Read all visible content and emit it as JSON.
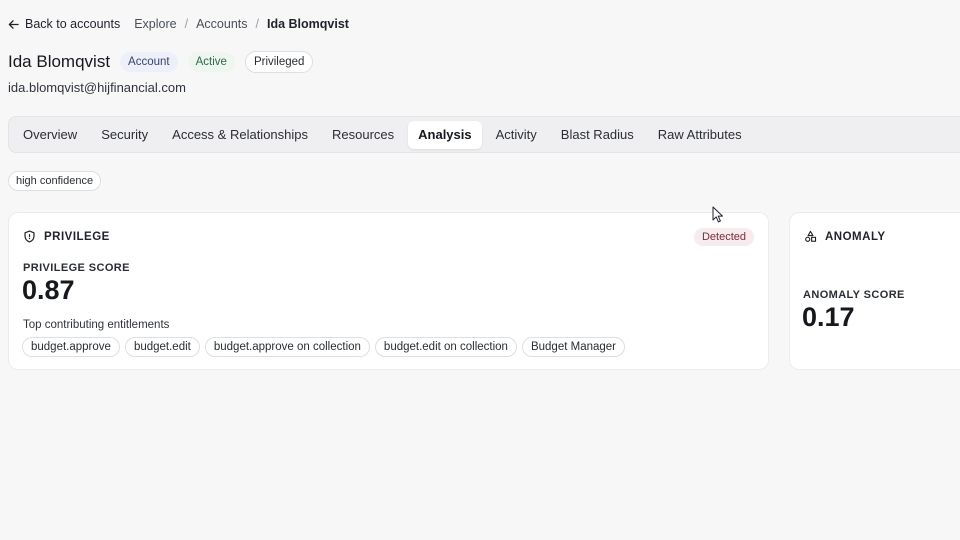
{
  "nav": {
    "back_label": "Back to accounts",
    "breadcrumb": [
      "Explore",
      "Accounts",
      "Ida Blomqvist"
    ]
  },
  "account": {
    "name": "Ida Blomqvist",
    "badges": {
      "type": "Account",
      "status": "Active",
      "privileged": "Privileged"
    },
    "email": "ida.blomqvist@hijfinancial.com"
  },
  "tabs": [
    "Overview",
    "Security",
    "Access & Relationships",
    "Resources",
    "Analysis",
    "Activity",
    "Blast Radius",
    "Raw Attributes"
  ],
  "active_tab": "Analysis",
  "confidence": "high confidence",
  "privilege_card": {
    "title": "PRIVILEGE",
    "status": "Detected",
    "score_label": "PRIVILEGE SCORE",
    "score": "0.87",
    "entitlements_label": "Top contributing entitlements",
    "entitlements": [
      "budget.approve",
      "budget.edit",
      "budget.approve on collection",
      "budget.edit on collection",
      "Budget Manager"
    ]
  },
  "anomaly_card": {
    "title": "ANOMALY",
    "score_label": "ANOMALY SCORE",
    "score": "0.17"
  },
  "colors": {
    "background": "#f7f7f8",
    "detected_bg": "#f6ebed",
    "detected_text": "#7a2d3a",
    "active_badge": "#2f6a46"
  },
  "icons": {
    "back": "arrow-left-icon",
    "privilege": "shield-icon",
    "anomaly": "shapes-icon",
    "cursor": "mouse-pointer-icon"
  }
}
